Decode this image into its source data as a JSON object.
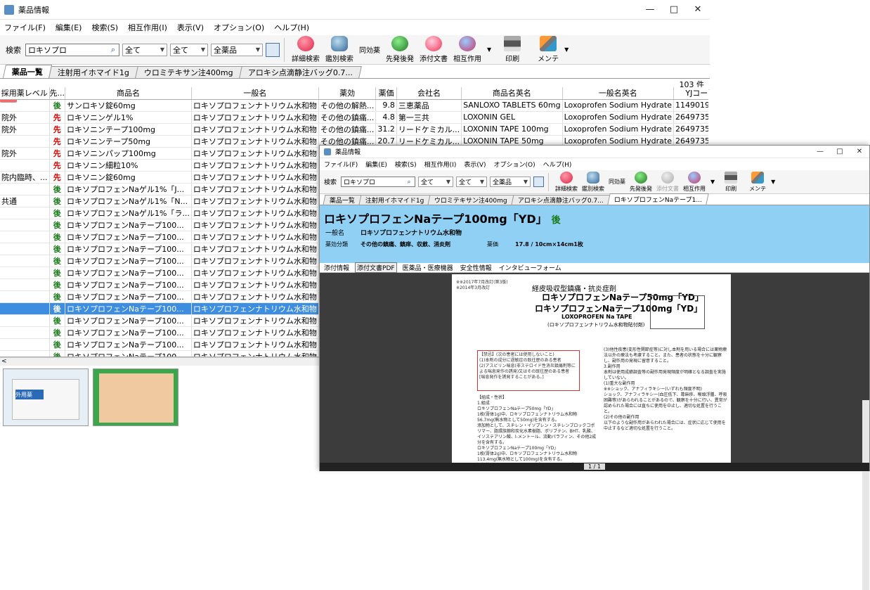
{
  "main": {
    "title": "薬品情報",
    "menu": [
      "ファイル(F)",
      "編集(E)",
      "検索(S)",
      "相互作用(I)",
      "表示(V)",
      "オプション(O)",
      "ヘルプ(H)"
    ],
    "search_label": "検索",
    "search_value": "ロキソプロ",
    "sel1": "全て",
    "sel2": "全て",
    "sel3": "全薬品",
    "tools": [
      "詳細検索",
      "鑑別検索",
      "同効薬",
      "先発後発",
      "添付文書",
      "相互作用",
      "印刷",
      "メンテ"
    ],
    "tabs": [
      "薬品一覧",
      "注射用イホマイド1g",
      "ウロミテキサン注400mg",
      "アロキシ点滴静注バッグ0.7..."
    ],
    "count": "103 件",
    "columns": [
      "採用薬レベル",
      "先...",
      "商品名",
      "一般名",
      "薬効",
      "薬価",
      "会社名",
      "商品名英名",
      "一般名英名",
      "YJコード"
    ],
    "rows": [
      [
        "",
        "後",
        "サンロキソ錠60mg",
        "ロキソプロフェンナトリウム水和物",
        "その他の解熱...",
        "9.8",
        "三恵薬品",
        "SANLOXO TABLETS 60mg",
        "Loxoprofen Sodium Hydrate",
        "1149019F15"
      ],
      [
        "院外",
        "先",
        "ロキソニンゲル1%",
        "ロキソプロフェンナトリウム水和物",
        "その他の鎮痛...",
        "4.8",
        "第一三共",
        "LOXONIN GEL",
        "Loxoprofen Sodium Hydrate",
        "2649735Q10"
      ],
      [
        "院外",
        "先",
        "ロキソニンテープ100mg",
        "ロキソプロフェンナトリウム水和物",
        "その他の鎮痛...",
        "31.2",
        "リードケミカル...",
        "LOXONIN TAPE 100mg",
        "Loxoprofen Sodium Hydrate",
        "2649735S30"
      ],
      [
        "",
        "先",
        "ロキソニンテープ50mg",
        "ロキソプロフェンナトリウム水和物",
        "その他の鎮痛...",
        "20.7",
        "リードケミカル...",
        "LOXONIN TAPE 50mg",
        "Loxoprofen Sodium Hydrate",
        "2649735S20"
      ],
      [
        "院外",
        "先",
        "ロキソニンパップ100mg",
        "ロキソプロフェンナトリウム水和物",
        "その他の",
        "",
        "",
        "",
        "",
        ""
      ],
      [
        "",
        "先",
        "ロキソニン細粒10%",
        "ロキソプロフェンナトリウム水和物",
        "その他の",
        "",
        "",
        "",
        "",
        ""
      ],
      [
        "院内臨時、...",
        "先",
        "ロキソニン錠60mg",
        "ロキソプロフェンナトリウム水和物",
        "その他の",
        "",
        "",
        "",
        "",
        ""
      ],
      [
        "",
        "後",
        "ロキソプロフェンNaゲル1%「J...",
        "ロキソプロフェンナトリウム水和物",
        "その他の",
        "",
        "",
        "",
        "",
        ""
      ],
      [
        "共通",
        "後",
        "ロキソプロフェンNaゲル1%「N...",
        "ロキソプロフェンナトリウム水和物",
        "その他の",
        "",
        "",
        "",
        "",
        ""
      ],
      [
        "",
        "後",
        "ロキソプロフェンNaゲル1%「ラ...",
        "ロキソプロフェンナトリウム水和物",
        "その他の",
        "",
        "",
        "",
        "",
        ""
      ],
      [
        "",
        "後",
        "ロキソプロフェンNaテープ100...",
        "ロキソプロフェンナトリウム水和物",
        "その他の",
        "",
        "",
        "",
        "",
        ""
      ],
      [
        "",
        "後",
        "ロキソプロフェンNaテープ100...",
        "ロキソプロフェンナトリウム水和物",
        "その他の",
        "",
        "",
        "",
        "",
        ""
      ],
      [
        "",
        "後",
        "ロキソプロフェンNaテープ100...",
        "ロキソプロフェンナトリウム水和物",
        "その他の",
        "",
        "",
        "",
        "",
        ""
      ],
      [
        "",
        "後",
        "ロキソプロフェンNaテープ100...",
        "ロキソプロフェンナトリウム水和物",
        "その他の",
        "",
        "",
        "",
        "",
        ""
      ],
      [
        "",
        "後",
        "ロキソプロフェンNaテープ100...",
        "ロキソプロフェンナトリウム水和物",
        "その他の",
        "",
        "",
        "",
        "",
        ""
      ],
      [
        "",
        "後",
        "ロキソプロフェンNaテープ100...",
        "ロキソプロフェンナトリウム水和物",
        "その他の",
        "",
        "",
        "",
        "",
        ""
      ],
      [
        "",
        "後",
        "ロキソプロフェンNaテープ100...",
        "ロキソプロフェンナトリウム水和物",
        "その他の",
        "",
        "",
        "",
        "",
        ""
      ],
      [
        "",
        "後",
        "ロキソプロフェンNaテープ100...",
        "ロキソプロフェンナトリウム水和物",
        "その他の",
        "",
        "",
        "",
        "",
        ""
      ],
      [
        "",
        "後",
        "ロキソプロフェンNaテープ100...",
        "ロキソプロフェンナトリウム水和物",
        "その他の",
        "",
        "",
        "",
        "",
        ""
      ],
      [
        "",
        "後",
        "ロキソプロフェンNaテープ100...",
        "ロキソプロフェンナトリウム水和物",
        "その他の",
        "",
        "",
        "",
        "",
        ""
      ],
      [
        "",
        "後",
        "ロキソプロフェンNaテープ100...",
        "ロキソプロフェンナトリウム水和物",
        "その他の",
        "",
        "",
        "",
        "",
        ""
      ],
      [
        "",
        "後",
        "ロキソプロフェンNaテープ100...",
        "ロキソプロフェンナトリウム水和物",
        "その他の",
        "",
        "",
        "",
        "",
        ""
      ],
      [
        "",
        "後",
        "ロキソプロフェンNaテープ100...",
        "ロキソプロフェンナトリウム水和物",
        "その他の",
        "",
        "",
        "",
        "",
        ""
      ],
      [
        "",
        "後",
        "ロキソプロフェンNaテープ100...",
        "ロキソプロフェンナトリウム水和物",
        "その他の",
        "",
        "",
        "",
        "",
        ""
      ]
    ],
    "selected_row": 17,
    "thumb_label": "外用薬"
  },
  "detail": {
    "title": "薬品情報",
    "menu": [
      "ファイル(F)",
      "編集(E)",
      "検索(S)",
      "相互作用(I)",
      "表示(V)",
      "オプション(O)",
      "ヘルプ(H)"
    ],
    "search_label": "検索",
    "search_value": "ロキソプロ",
    "sel1": "全て",
    "sel2": "全て",
    "sel3": "全薬品",
    "tools": [
      "詳細検索",
      "鑑別検索",
      "同効薬",
      "先発後発",
      "添付文書",
      "相互作用",
      "印刷",
      "メンテ"
    ],
    "tabs": [
      "薬品一覧",
      "注射用イホマイド1g",
      "ウロミテキサン注400mg",
      "アロキシ点滴静注バッグ0.7...",
      "ロキソプロフェンNaテープ1..."
    ],
    "drug_name": "ロキソプロフェンNaテープ100mg「YD」",
    "badge": "後",
    "generic_label": "一般名",
    "generic_value": "ロキソプロフェンナトリウム水和物",
    "effect_label": "薬効分類",
    "effect_value": "その他の鎮痛、鎮痒、収斂、消炎剤",
    "price_label": "薬価",
    "price_value": "17.8 / 10cm×14cm1枚",
    "subtabs": [
      "添付情報",
      "添付文書PDF",
      "医薬品・医療機器",
      "安全性情報",
      "インタビューフォーム"
    ],
    "page_indicator": "1 / 1",
    "pdf": {
      "heading1": "経皮吸収型鎮痛・抗炎症剤",
      "heading2": "ロキソプロフェンNaテープ50mg「YD」",
      "heading3": "ロキソプロフェンNaテープ100mg「YD」",
      "heading4": "LOXOPROFEN Na TAPE",
      "heading5": "(ロキソプロフェンナトリウム水和物貼付剤)",
      "revision": "※※2017年7月改訂(第3版)\n※2014年3月改訂",
      "warning": "【禁忌】(次の患者には使用しないこと)\n(1)本剤の成分に過敏症の既往歴のある患者\n(2)アスピリン喘息(非ステロイド性消炎鎮痛剤等による喘息発作の誘発)又はその既往歴のある患者\n[喘息発作を誘発することがある。]",
      "composition": "【組成・性状】\n1.組成\nロキソプロフェンNaテープ50mg「YD」\n1枚(膏体1g)中、ロキソプロフェンナトリウム水和物56.7mg(無水物として50mg)を含有する。\n添加物として、スチレン・イソプレン・スチレンブロックコポリマー、脂環族飽和炭化水素樹脂、ポリブテン、BHT、乳酸、イソステアリン酸、l-メントール、流動パラフィン、その他2成分を含有する。\nロキソプロフェンNaテープ100mg「YD」\n1枚(膏体2g)中、ロキソプロフェンナトリウム水和物113.4mg(無水物として100mg)を含有する。\n添加物として、スチレン・イソプレン・スチレンブ",
      "right_col": "(3)他性疾患(変形性関節症等)に対し本剤を用いる場合には薬物療法以外の療法も考慮すること。また、患者の状態を十分に観察し、副作用の発現に留意すること。\n3.副作用\n本剤は使用成績調査等の副作用発現頻度が明確となる調査を実施していない。\n(1)重大な副作用\n※※ショック、アナフィラキシー(いずれも頻度不明)\nショック、アナフィラキシー(血圧低下、蕁麻疹、喉頭浮腫、呼吸困難等)があらわれることがあるので、観察を十分に行い、異常が認められた場合には直ちに使用を中止し、適切な処置を行うこと。\n(2)その他の副作用\n以下のような副作用があらわれた場合には、症状に応じて使用を中止するなど適切な処置を行うこと。"
    }
  }
}
